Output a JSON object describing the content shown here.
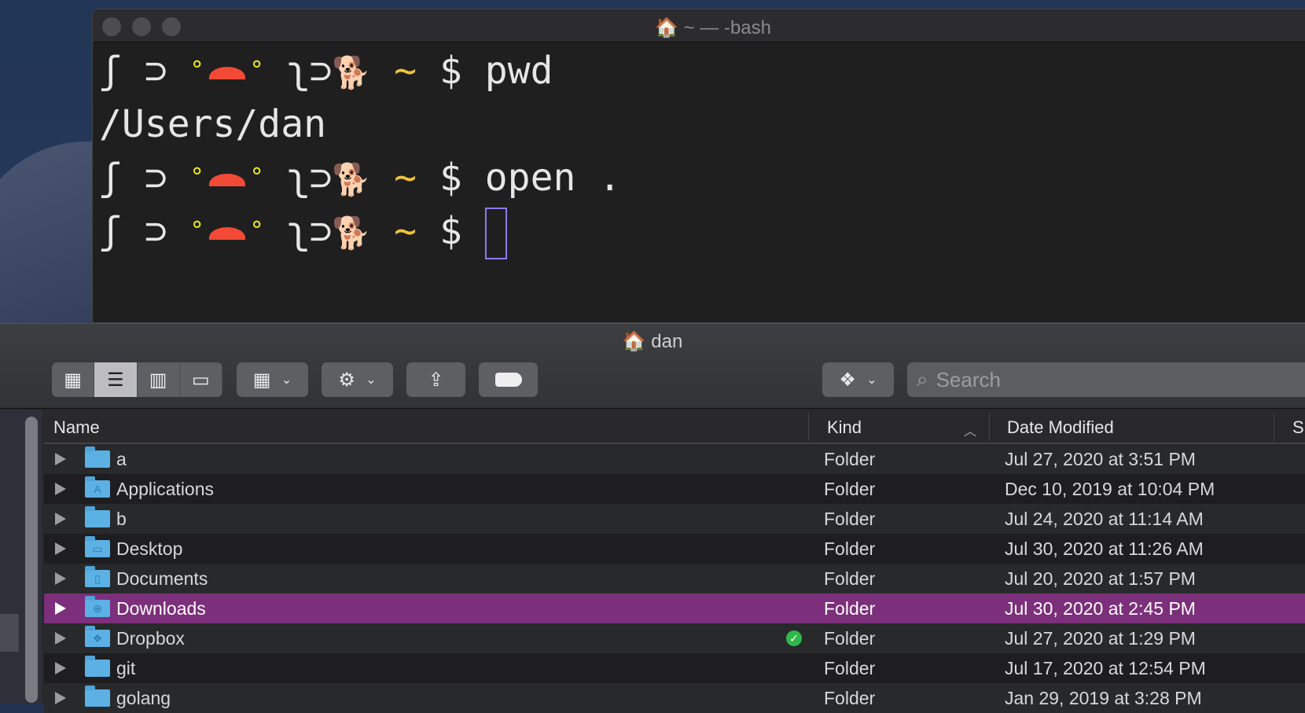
{
  "terminal": {
    "title": "~ — -bash",
    "prompt": {
      "left": "ʃ ⊃ ",
      "eye": "°",
      "right": "ʅ⊃",
      "pet": "🐕",
      "tilde": "~",
      "dollar": "$"
    },
    "lines": [
      {
        "type": "prompt",
        "command": "pwd"
      },
      {
        "type": "output",
        "text": "/Users/dan"
      },
      {
        "type": "prompt",
        "command": "open ."
      },
      {
        "type": "prompt",
        "command": ""
      }
    ]
  },
  "finder": {
    "title": "dan",
    "toolbar": {
      "view_icons": [
        "grid-view-icon",
        "list-view-icon",
        "column-view-icon",
        "gallery-view-icon"
      ],
      "search_placeholder": "Search"
    },
    "columns": {
      "name": "Name",
      "kind": "Kind",
      "date": "Date Modified",
      "size": "S"
    },
    "rows": [
      {
        "name": "a",
        "kind": "Folder",
        "date": "Jul 27, 2020 at 3:51 PM",
        "glyph": ""
      },
      {
        "name": "Applications",
        "kind": "Folder",
        "date": "Dec 10, 2019 at 10:04 PM",
        "glyph": "A"
      },
      {
        "name": "b",
        "kind": "Folder",
        "date": "Jul 24, 2020 at 11:14 AM",
        "glyph": ""
      },
      {
        "name": "Desktop",
        "kind": "Folder",
        "date": "Jul 30, 2020 at 11:26 AM",
        "glyph": "▭"
      },
      {
        "name": "Documents",
        "kind": "Folder",
        "date": "Jul 20, 2020 at 1:57 PM",
        "glyph": "▯"
      },
      {
        "name": "Downloads",
        "kind": "Folder",
        "date": "Jul 30, 2020 at 2:45 PM",
        "glyph": "⊕",
        "selected": true
      },
      {
        "name": "Dropbox",
        "kind": "Folder",
        "date": "Jul 27, 2020 at 1:29 PM",
        "glyph": "❖",
        "synced": true
      },
      {
        "name": "git",
        "kind": "Folder",
        "date": "Jul 17, 2020 at 12:54 PM",
        "glyph": ""
      },
      {
        "name": "golang",
        "kind": "Folder",
        "date": "Jan 29, 2019 at 3:28 PM",
        "glyph": ""
      }
    ],
    "selection_color": "#7c2f7a"
  }
}
